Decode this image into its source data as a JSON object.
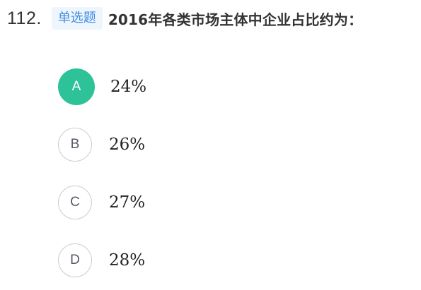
{
  "question": {
    "number": "112.",
    "type_label": "单选题",
    "text": "2016年各类市场主体中企业占比约为："
  },
  "options": [
    {
      "letter": "A",
      "text": "24%",
      "selected": true
    },
    {
      "letter": "B",
      "text": "26%",
      "selected": false
    },
    {
      "letter": "C",
      "text": "27%",
      "selected": false
    },
    {
      "letter": "D",
      "text": "28%",
      "selected": false
    }
  ],
  "colors": {
    "selected": "#2dc298",
    "badge_text": "#3d8de0",
    "badge_bg": "#eef5fd"
  }
}
